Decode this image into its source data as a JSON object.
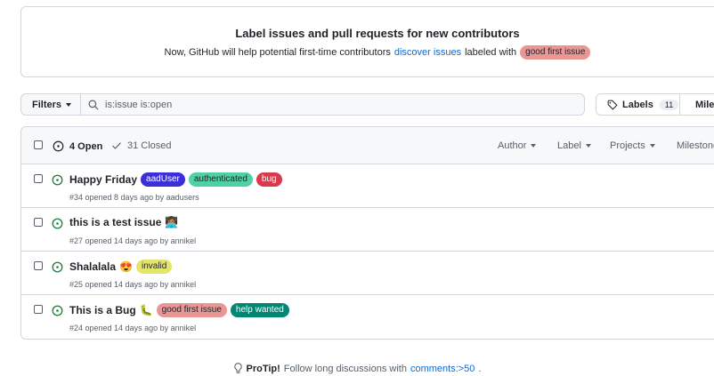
{
  "banner": {
    "title": "Label issues and pull requests for new contributors",
    "text_before": "Now, GitHub will help potential first-time contributors",
    "link": "discover issues",
    "text_after": "labeled with",
    "label": {
      "name": "good first issue",
      "color": "#e99695"
    }
  },
  "toolbar": {
    "filters_label": "Filters",
    "search_value": "is:issue is:open",
    "labels_label": "Labels",
    "labels_count": "11",
    "milestones_label": "Milestones"
  },
  "header": {
    "open_label": "4 Open",
    "closed_label": "31 Closed",
    "filters": [
      "Author",
      "Label",
      "Projects",
      "Milestones"
    ]
  },
  "issues": [
    {
      "title": "Happy Friday",
      "emoji": "",
      "meta": "#34 opened 8 days ago by aadusers",
      "labels": [
        {
          "name": "aadUser",
          "bg": "#3b2fd9",
          "fg": "#ffffff"
        },
        {
          "name": "authenticated",
          "bg": "#4fd1a5",
          "fg": "#1f2328"
        },
        {
          "name": "bug",
          "bg": "#d73a4a",
          "fg": "#ffffff"
        }
      ]
    },
    {
      "title": "this is a test issue",
      "emoji": "👩🏽‍💻",
      "meta": "#27 opened 14 days ago by annikel",
      "labels": []
    },
    {
      "title": "Shalalala",
      "emoji": "😍",
      "meta": "#25 opened 14 days ago by annikel",
      "labels": [
        {
          "name": "invalid",
          "bg": "#e4e669",
          "fg": "#1f2328"
        }
      ]
    },
    {
      "title": "This is a Bug",
      "emoji": "🐛",
      "meta": "#24 opened 14 days ago by annikel",
      "labels": [
        {
          "name": "good first issue",
          "bg": "#e99695",
          "fg": "#1f2328"
        },
        {
          "name": "help wanted",
          "bg": "#008672",
          "fg": "#ffffff"
        }
      ]
    }
  ],
  "protip": {
    "bold": "ProTip!",
    "text": "Follow long discussions with",
    "link": "comments:>50",
    "end": "."
  },
  "colors": {
    "accent": "#0969da",
    "open": "#1a7f37",
    "border": "#d0d7de"
  }
}
